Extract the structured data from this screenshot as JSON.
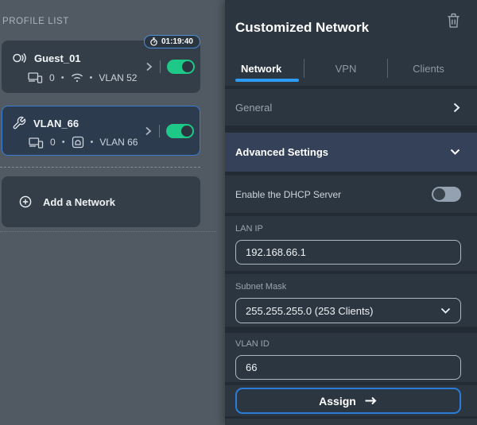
{
  "colors": {
    "page_bg": "#515a63",
    "card_bg": "#333e48",
    "selected_card_bg": "#2d3b4f",
    "selected_card_border": "#3b7cd2",
    "panel_row_bg": "#2c3640",
    "advanced_row_bg": "#344158",
    "accent_blue": "#2e9cf4",
    "toggle_on_green": "#1ec887",
    "toggle_off_track": "#94a1b1",
    "input_border": "#aeb8c1"
  },
  "profile_list": {
    "title": "PROFILE LIST",
    "dot": "•",
    "cards": [
      {
        "icon": "guest-icon",
        "name": "Guest_01",
        "timer": "01:19:40",
        "client_count": "0",
        "type_icon": "wifi-icon",
        "vlan": "VLAN 52",
        "enabled": "on"
      },
      {
        "icon": "wrench-icon",
        "name": "VLAN_66",
        "client_count": "0",
        "type_icon": "port-icon",
        "vlan": "VLAN 66",
        "enabled": "on",
        "selected": "true"
      }
    ],
    "add_button_label": "Add a Network"
  },
  "panel": {
    "title": "Customized Network",
    "delete_icon": "trash-icon",
    "tabs": [
      {
        "label": "Network",
        "active": "true"
      },
      {
        "label": "VPN"
      },
      {
        "label": "Clients"
      }
    ],
    "general_label": "General",
    "advanced_label": "Advanced Settings",
    "dhcp": {
      "label": "Enable the DHCP Server",
      "enabled": "off"
    },
    "lan_ip": {
      "label": "LAN IP",
      "value": "192.168.66.1"
    },
    "subnet_mask": {
      "label": "Subnet Mask",
      "value": "255.255.255.0 (253 Clients)"
    },
    "vlan_id": {
      "label": "VLAN ID",
      "value": "66"
    },
    "assign": {
      "label": "Assign"
    }
  }
}
